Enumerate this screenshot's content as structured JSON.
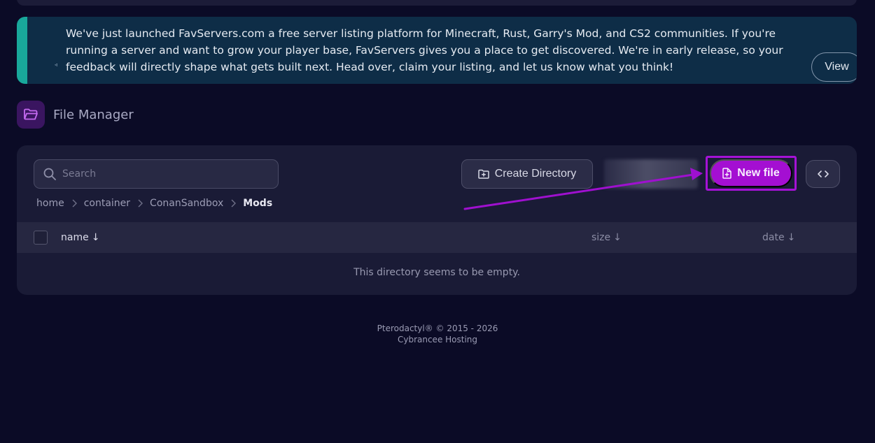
{
  "announcement": {
    "text": "We've just launched FavServers.com a free server listing platform for Minecraft, Rust, Garry's Mod, and CS2 communities. If you're running a server and want to grow your player base, FavServers gives you a place to get discovered. We're in early release, so your feedback will directly shape what gets built next. Head over, claim your listing, and let us know what you think!",
    "view_label": "View",
    "accent_color": "#19a89b"
  },
  "file_manager": {
    "title": "File Manager",
    "search_placeholder": "Search",
    "create_directory_label": "Create Directory",
    "new_file_label": "New file",
    "breadcrumb": [
      "home",
      "container",
      "ConanSandbox",
      "Mods"
    ],
    "columns": {
      "name": "name",
      "size": "size",
      "date": "date",
      "sort_arrow": "↓"
    },
    "empty_message": "This directory seems to be empty."
  },
  "footer": {
    "copyright": "Pterodactyl® © 2015 - 2026",
    "host": "Cybrancee Hosting"
  },
  "colors": {
    "background": "#0b0b26",
    "panel": "#1a1b36",
    "primary": "#a40fd2",
    "highlight": "#a512d6"
  }
}
